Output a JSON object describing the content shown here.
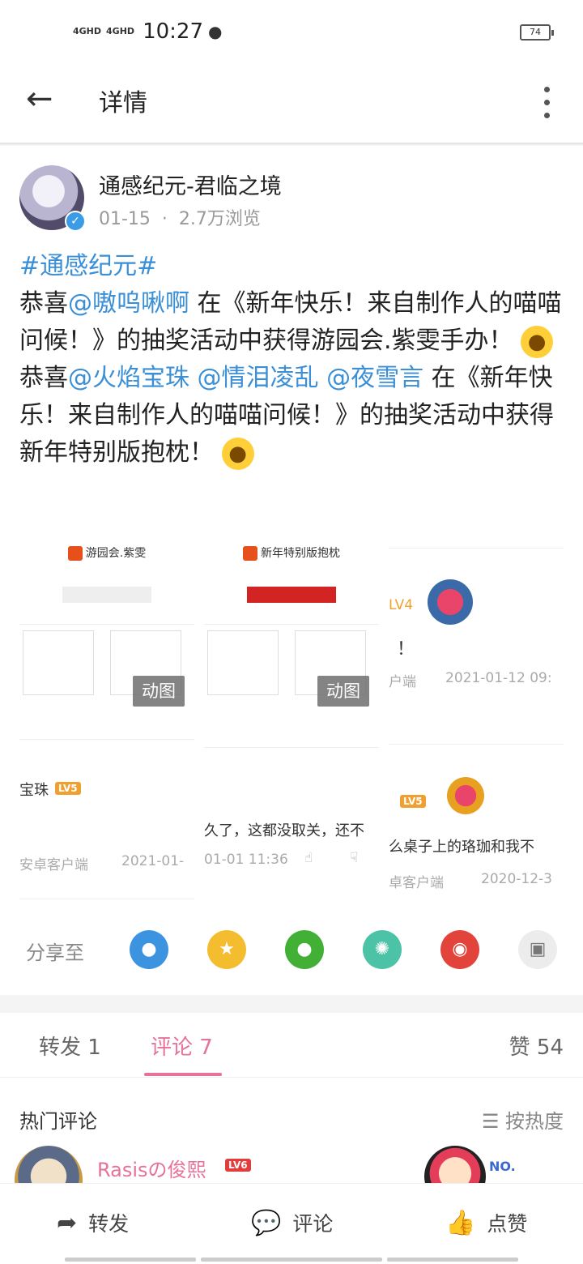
{
  "status_bar": {
    "signal1": "4GHD",
    "signal2": "4GHD",
    "time": "10:27",
    "battery": "74"
  },
  "app_bar": {
    "title": "详情"
  },
  "post": {
    "author": "通感纪元-君临之境",
    "date": "01-15",
    "views": "2.7万浏览",
    "hashtag": "#通感纪元#",
    "p1_a": "恭喜",
    "p1_mention": "@嗷呜啾啊",
    "p1_b": " 在《新年快乐！来自制作人的喵喵问候！》的抽奖活动中获得游园会.紫雯手办！",
    "p2_a": "恭喜",
    "p2_m1": "@火焰宝珠",
    "p2_m2": "@情泪凌乱",
    "p2_m3": "@夜雪言",
    "p2_b": " 在《新年快乐！来自制作人的喵喵问候！》的抽奖活动中获得 新年特别版抱枕！"
  },
  "images": {
    "img1_title": "游园会.紫雯",
    "img2_title": "新年特别版抱枕",
    "gif_label": "动图",
    "cell3_lv": "LV4",
    "cell3_exclaim": "！",
    "cell3_client": "户端",
    "cell3_time": "2021-01-12 09:",
    "cell4_name": "宝珠",
    "cell4_lv": "LV5",
    "cell4_client": "安卓客户端",
    "cell4_time": "2021-01-",
    "cell5_text": "久了，这都没取关，还不",
    "cell5_time": "01-01 11:36",
    "cell6_lv": "LV5",
    "cell6_text": "么桌子上的珞珈和我不",
    "cell6_client": "卓客户端",
    "cell6_time": "2020-12-3"
  },
  "share": {
    "label": "分享至"
  },
  "tabs": {
    "repost": "转发 1",
    "comment": "评论 7",
    "like": "赞 54"
  },
  "comments": {
    "hot_label": "热门评论",
    "sort_label": "按热度",
    "first_name": "Rasisの俊熙",
    "first_lv": "LV6",
    "no_label": "NO."
  },
  "bottom": {
    "repost": "转发",
    "comment": "评论",
    "like": "点赞"
  },
  "colors": {
    "accent": "#e6719b",
    "link": "#3a8fd6"
  }
}
